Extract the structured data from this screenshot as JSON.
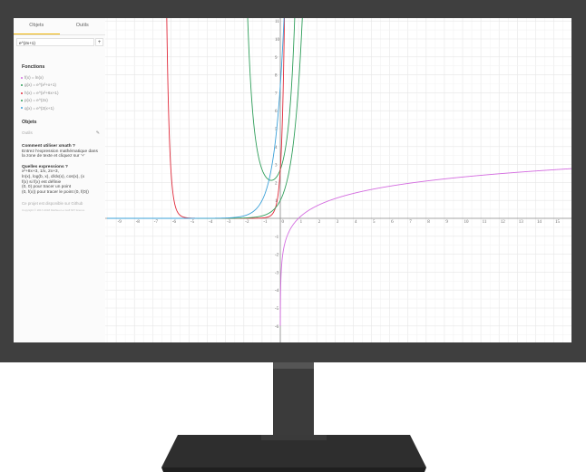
{
  "sidebar": {
    "tabs": [
      {
        "label": "Objets"
      },
      {
        "label": "Outils"
      }
    ],
    "input": {
      "value": "e^(2x+1)"
    },
    "add_button": "+",
    "functions_title": "Fonctions",
    "functions": [
      {
        "label": "f(x) = ln(x)",
        "color": "#d46de0"
      },
      {
        "label": "g(x) = e^(x²+x+1)",
        "color": "#2f9e5a"
      },
      {
        "label": "h(x) = e^(x²+6x+1)",
        "color": "#e02a3a"
      },
      {
        "label": "p(x) = e^(2x)",
        "color": "#2f9e5a"
      },
      {
        "label": "q(x) = e^(2(x+1)",
        "color": "#3aa0d8"
      }
    ],
    "objects_title": "Objets",
    "objects_placeholder": "Outils",
    "help": {
      "title1": "Comment utiliser xmath ?",
      "body1": "Entrez l'expression mathématique dans la zone de texte et cliquez sur '+'",
      "title2": "Quelles expressions ?",
      "body2": "x²+8x+3, 1/x, 2x+3,\nln(x), log(b, x), d/dx(x), cos(x), (x\nf(x) si f(x) est définie\n(0, 0) pour tracer un point\n(0, f(x)) pour tracer le point (0, f(0))"
    },
    "notes": "Ce projet est disponible sur Github",
    "copyright": "Copyright © 2017-2018 Mathieu Le Goff MIT licence"
  },
  "chart_data": {
    "type": "line",
    "xlim": [
      -9.5,
      16
    ],
    "ylim": [
      -7,
      11
    ],
    "xticks": [
      -9,
      -8,
      -7,
      -6,
      -5,
      -4,
      -3,
      -2,
      -1,
      0,
      1,
      2,
      3,
      4,
      5,
      6,
      7,
      8,
      9,
      10,
      11,
      12,
      13,
      14,
      15
    ],
    "yticks": [
      -6,
      -5,
      -4,
      -3,
      -2,
      -1,
      1,
      2,
      3,
      4,
      5,
      6,
      7,
      8,
      9,
      10,
      11
    ],
    "grid": true,
    "series": [
      {
        "name": "f(x) = ln(x)",
        "formula": "ln(x)",
        "color": "#d46de0"
      },
      {
        "name": "g(x) = e^(x²+x+1)",
        "formula": "e^(x²+x+1)",
        "color": "#2f9e5a"
      },
      {
        "name": "h(x) = e^(x²+6x+1)",
        "formula": "e^(x²+6x+1)",
        "color": "#e02a3a"
      },
      {
        "name": "p(x) = e^(2x)",
        "formula": "e^(2x)",
        "color": "#2f9e5a"
      },
      {
        "name": "q(x) = e^(2(x+1)",
        "formula": "e^(2(x+1))",
        "color": "#3aa0d8"
      }
    ]
  }
}
